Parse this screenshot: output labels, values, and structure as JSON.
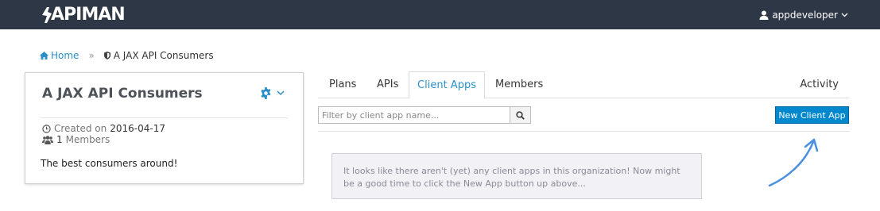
{
  "navbar": {
    "brand": "APIMAN",
    "user_label": "appdeveloper"
  },
  "breadcrumb": {
    "home_label": "Home",
    "separator": "»",
    "current_label": "A JAX API Consumers"
  },
  "org": {
    "title": "A JAX API Consumers",
    "created_label": "Created on",
    "created_value": "2016-04-17",
    "members_count": "1",
    "members_label": "Members",
    "description": "The best consumers around!"
  },
  "tabs": {
    "plans": "Plans",
    "apis": "APIs",
    "client_apps": "Client Apps",
    "members": "Members",
    "activity": "Activity"
  },
  "filter": {
    "placeholder": "Filter by client app name...",
    "value": ""
  },
  "actions": {
    "new_client_app": "New Client App"
  },
  "empty_notice": "It looks like there aren't (yet) any client apps in this organization! Now might be a good time to click the New App button up above...",
  "colors": {
    "navbar_bg": "#2e3745",
    "accent": "#2a8fc9",
    "primary_button": "#0088ce",
    "arrow": "#4a90e2"
  }
}
